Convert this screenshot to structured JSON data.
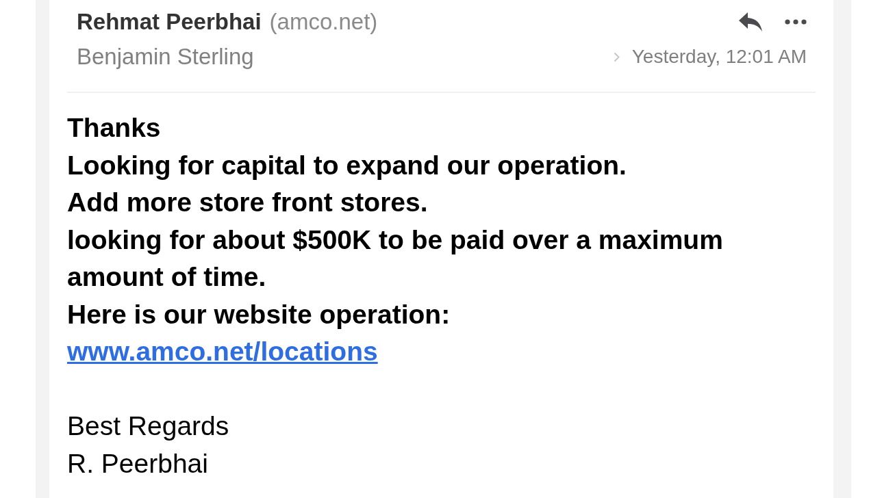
{
  "message": {
    "sender": {
      "name": "Rehmat Peerbhai",
      "domain": "(amco.net)"
    },
    "recipient": "Benjamin Sterling",
    "timestamp": "Yesterday, 12:01 AM",
    "body": {
      "lines": [
        "Thanks",
        "Looking for capital to expand our operation.",
        "Add more store front stores.",
        "looking for about $500K to be paid over a maximum amount of time.",
        "Here is our website operation:"
      ],
      "link": "www.amco.net/locations"
    },
    "signature": [
      "Best Regards",
      "R. Peerbhai"
    ]
  }
}
